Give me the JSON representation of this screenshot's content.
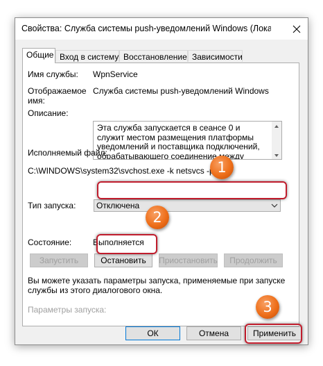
{
  "window": {
    "title": "Свойства: Служба системы push-уведомлений Windows (Локал"
  },
  "tabs": [
    {
      "label": "Общие"
    },
    {
      "label": "Вход в систему"
    },
    {
      "label": "Восстановление"
    },
    {
      "label": "Зависимости"
    }
  ],
  "fields": {
    "service_name_label": "Имя службы:",
    "service_name_value": "WpnService",
    "display_name_label_1": "Отображаемое",
    "display_name_label_2": "имя:",
    "display_name_value": "Служба системы push-уведомлений Windows",
    "description_label": "Описание:",
    "description_value": "Эта служба запускается в сеансе 0 и служит местом размещения платформы уведомлений и поставщика подключений, обрабатывающего соединение между устройством и сервером",
    "executable_label": "Исполняемый файл:",
    "executable_value": "C:\\WINDOWS\\system32\\svchost.exe -k netsvcs -p",
    "startup_type_label": "Тип запуска:",
    "startup_type_value": "Отключена",
    "status_label": "Состояние:",
    "status_value": "Выполняется"
  },
  "service_buttons": {
    "start": "Запустить",
    "stop": "Остановить",
    "pause": "Приостановить",
    "resume": "Продолжить"
  },
  "hint_line_1": "Вы можете указать параметры запуска, применяемые при запуске",
  "hint_line_2": "службы из этого диалогового окна.",
  "start_params_label": "Параметры запуска:",
  "footer": {
    "ok": "ОК",
    "cancel": "Отмена",
    "apply": "Применить"
  },
  "badges": {
    "one": "1",
    "two": "2",
    "three": "3"
  },
  "colors": {
    "highlight": "#c01c2c",
    "badge": "#ee6f1a"
  }
}
